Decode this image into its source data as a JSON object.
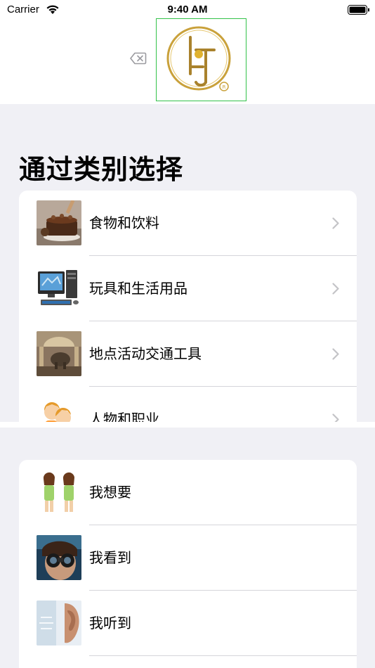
{
  "status_bar": {
    "carrier": "Carrier",
    "time": "9:40 AM"
  },
  "header": {
    "logo_icon": "brand-logo",
    "backspace_icon": "backspace-icon"
  },
  "section": {
    "title": "通过类别选择"
  },
  "categories": [
    {
      "label": "食物和饮料",
      "icon": "cake-photo"
    },
    {
      "label": "玩具和生活用品",
      "icon": "computer-photo"
    },
    {
      "label": "地点活动交通工具",
      "icon": "museum-photo"
    },
    {
      "label": "人物和职业",
      "icon": "children-illustration"
    }
  ],
  "phrases": [
    {
      "label": "我想要",
      "icon": "two-people-illustration"
    },
    {
      "label": "我看到",
      "icon": "binoculars-photo"
    },
    {
      "label": "我听到",
      "icon": "ear-photo"
    }
  ],
  "colors": {
    "background": "#f0f0f5",
    "logo_gold": "#c9a13b",
    "frame_green": "#33c24a",
    "chevron": "#c4c4c7"
  }
}
